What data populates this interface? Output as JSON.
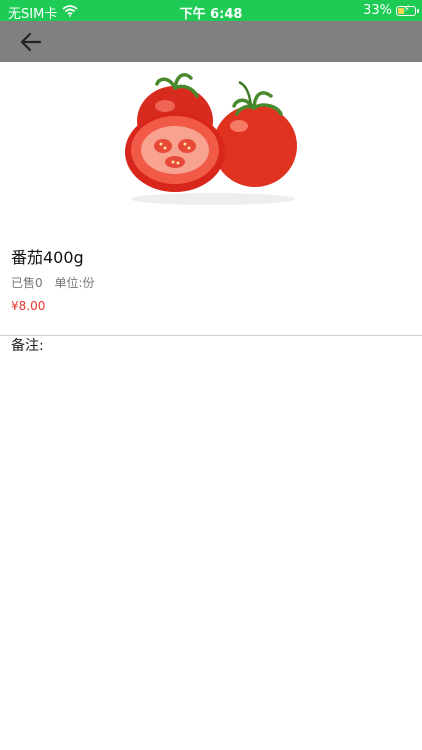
{
  "status_bar": {
    "carrier": "无SIM卡",
    "time": "下午 6:48",
    "battery": "33%",
    "wifi_icon": "wifi-icon",
    "battery_icon": "battery-charging-icon"
  },
  "nav": {
    "back_icon": "arrow-left-icon"
  },
  "product": {
    "image_icon": "tomato-image",
    "name": "番茄400g",
    "sold": "已售0",
    "unit": "单位:份",
    "price": "¥8.00",
    "remark_label": "备注:"
  },
  "colors": {
    "status_bar_bg": "#1ecb55",
    "nav_bg": "#808080",
    "price": "#e8362f"
  }
}
